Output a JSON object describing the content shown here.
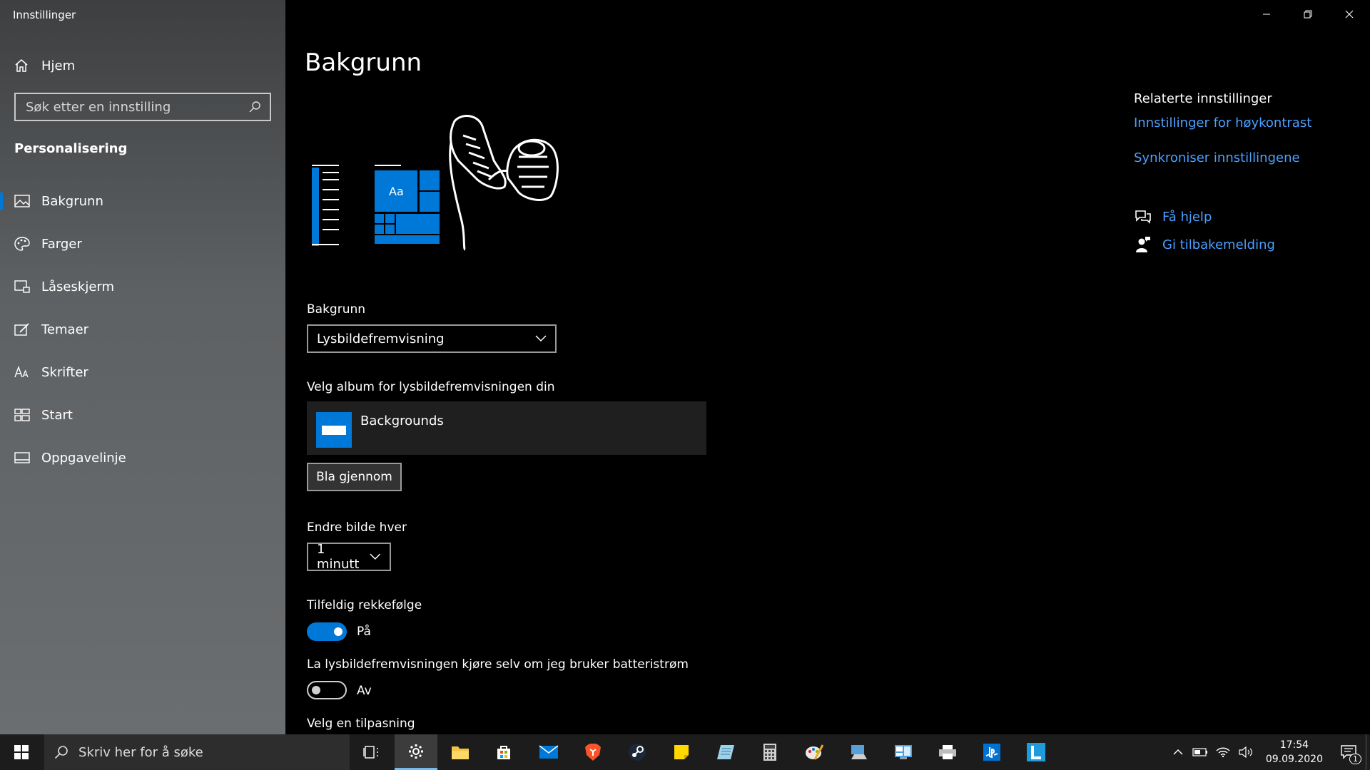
{
  "app": {
    "title": "Innstillinger"
  },
  "sidebar": {
    "home_label": "Hjem",
    "search_placeholder": "Søk etter en innstilling",
    "section_title": "Personalisering",
    "items": [
      {
        "label": "Bakgrunn",
        "icon": "picture-icon",
        "active": true
      },
      {
        "label": "Farger",
        "icon": "palette-icon"
      },
      {
        "label": "Låseskjerm",
        "icon": "lock-screen-icon"
      },
      {
        "label": "Temaer",
        "icon": "themes-icon"
      },
      {
        "label": "Skrifter",
        "icon": "fonts-icon"
      },
      {
        "label": "Start",
        "icon": "start-icon"
      },
      {
        "label": "Oppgavelinje",
        "icon": "taskbar-icon"
      }
    ]
  },
  "main": {
    "title": "Bakgrunn",
    "preview": {
      "tile_text": "Aa"
    },
    "background_label": "Bakgrunn",
    "background_value": "Lysbildefremvisning",
    "album_label": "Velg album for lysbildefremvisningen din",
    "album_name": "Backgrounds",
    "browse_label": "Bla gjennom",
    "interval_label": "Endre bilde hver",
    "interval_value": "1 minutt",
    "shuffle_label": "Tilfeldig rekkefølge",
    "shuffle_state": "På",
    "battery_label": "La lysbildefremvisningen kjøre selv om jeg bruker batteristrøm",
    "battery_state": "Av",
    "fit_label": "Velg en tilpasning"
  },
  "related": {
    "title": "Relaterte innstillinger",
    "links": [
      "Innstillinger for høykontrast",
      "Synkroniser innstillingene"
    ],
    "help": "Få hjelp",
    "feedback": "Gi tilbakemelding"
  },
  "taskbar": {
    "search_placeholder": "Skriv her for å søke",
    "time": "17:54",
    "date": "09.09.2020",
    "notification_count": "1"
  },
  "colors": {
    "accent": "#0078d7",
    "link": "#4ba0ff"
  }
}
